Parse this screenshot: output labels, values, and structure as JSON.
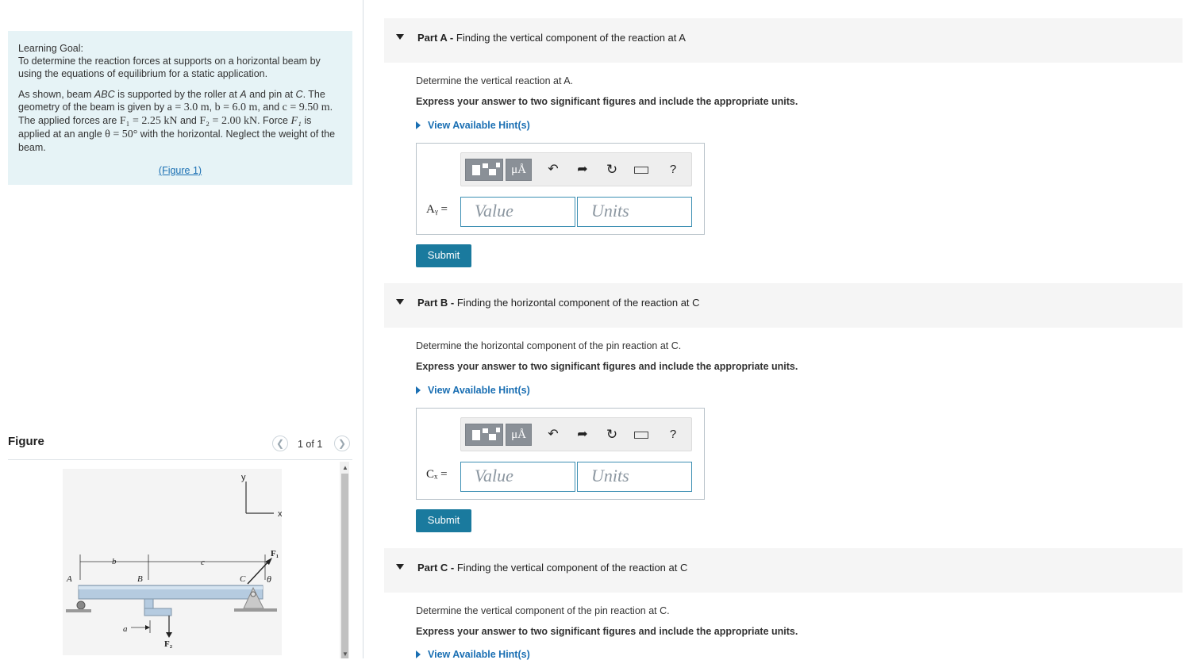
{
  "goal": {
    "title": "Learning Goal:",
    "intro": "To determine the reaction forces at supports on a horizontal beam by using the equations of equilibrium for a static application.",
    "p_start": "As shown, beam ",
    "beam": "ABC",
    "p_mid": " is supported by the roller at ",
    "roller": "A",
    "p_and": " and pin at ",
    "pin": "C",
    "p_geo": ". The geometry of the beam is given by ",
    "a_eq": "a = 3.0 m",
    "b_eq": "b = 6.0 m",
    "and1": ", and",
    "c_eq": "c = 9.50 m",
    "forces_txt": ". The applied forces are ",
    "f1_eq": "F₁ = 2.25 kN",
    "and2": " and",
    "f2_eq": "F₂ = 2.00 kN",
    "force_txt": ". Force ",
    "f1": "F₁",
    "angle_txt": " is applied at an angle ",
    "theta_eq": "θ = 50°",
    "end_txt": " with the horizontal. Neglect the weight of the beam.",
    "figure_link": "(Figure 1)"
  },
  "figure": {
    "title": "Figure",
    "counter": "1 of 1",
    "labels": {
      "y": "y",
      "x": "x",
      "b": "b",
      "c": "c",
      "a": "a",
      "A": "A",
      "B": "B",
      "C": "C",
      "F1": "F₁",
      "F2": "F₂",
      "theta": "θ"
    }
  },
  "toolbar": {
    "units_glyph": "μÅ",
    "help": "?"
  },
  "inputs": {
    "value_placeholder": "Value",
    "units_placeholder": "Units"
  },
  "submit_label": "Submit",
  "parts": [
    {
      "label": "Part A -",
      "title": "Finding the vertical component of the reaction at A",
      "prompt": "Determine the vertical reaction at A.",
      "instruction": "Express your answer to two significant figures and include the appropriate units.",
      "hint": "View Available Hint(s)",
      "var": "Aᵧ ="
    },
    {
      "label": "Part B -",
      "title": "Finding the horizontal component of the reaction at C",
      "prompt": "Determine the horizontal component of the pin reaction at C.",
      "instruction": "Express your answer to two significant figures and include the appropriate units.",
      "hint": "View Available Hint(s)",
      "var": "Cₓ ="
    },
    {
      "label": "Part C -",
      "title": "Finding the vertical component of the reaction at C",
      "prompt": "Determine the vertical component of the pin reaction at C.",
      "instruction": "Express your answer to two significant figures and include the appropriate units.",
      "hint": "View Available Hint(s)"
    }
  ]
}
